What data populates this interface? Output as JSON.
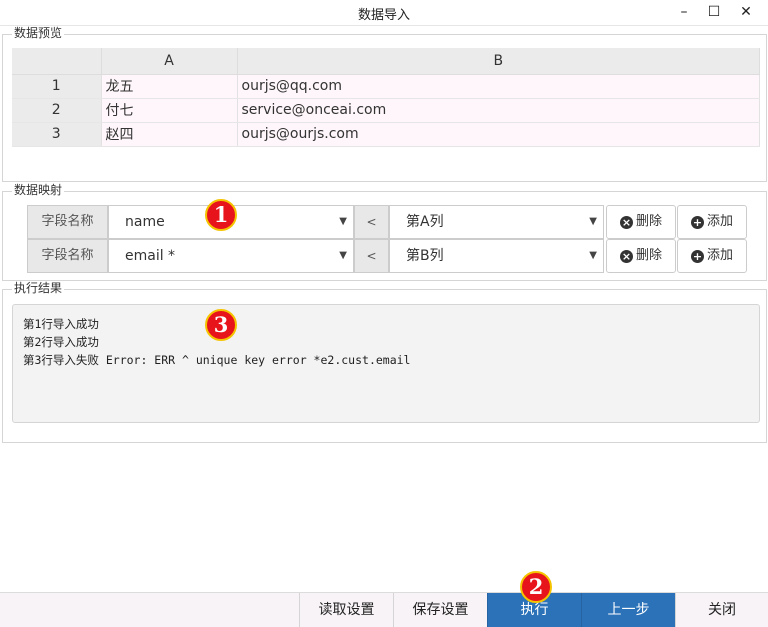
{
  "window": {
    "title": "数据导入",
    "minimize": "–",
    "maximize": "☐",
    "close": "✕"
  },
  "preview": {
    "legend": "数据预览",
    "columns": [
      "",
      "A",
      "B"
    ],
    "rows": [
      {
        "num": "1",
        "a": "龙五",
        "b": "ourjs@qq.com"
      },
      {
        "num": "2",
        "a": "付七",
        "b": "service@onceai.com"
      },
      {
        "num": "3",
        "a": "赵四",
        "b": "ourjs@ourjs.com"
      }
    ]
  },
  "mapping": {
    "legend": "数据映射",
    "rows": [
      {
        "label": "字段名称",
        "field": "name",
        "op": "<",
        "column": "第A列",
        "delete": "删除",
        "add": "添加"
      },
      {
        "label": "字段名称",
        "field": "email *",
        "op": "<",
        "column": "第B列",
        "delete": "删除",
        "add": "添加"
      }
    ]
  },
  "result": {
    "legend": "执行结果",
    "lines": [
      "第1行导入成功",
      "第2行导入成功",
      "第3行导入失败 Error: ERR ^ unique key error *e2.cust.email"
    ]
  },
  "markers": [
    "1",
    "2",
    "3"
  ],
  "footer": {
    "read_settings": "读取设置",
    "save_settings": "保存设置",
    "execute": "执行",
    "previous": "上一步",
    "close": "关闭"
  },
  "colors": {
    "primary": "#2b72b8",
    "marker": "#e8141b",
    "marker_border": "#f5c400"
  }
}
